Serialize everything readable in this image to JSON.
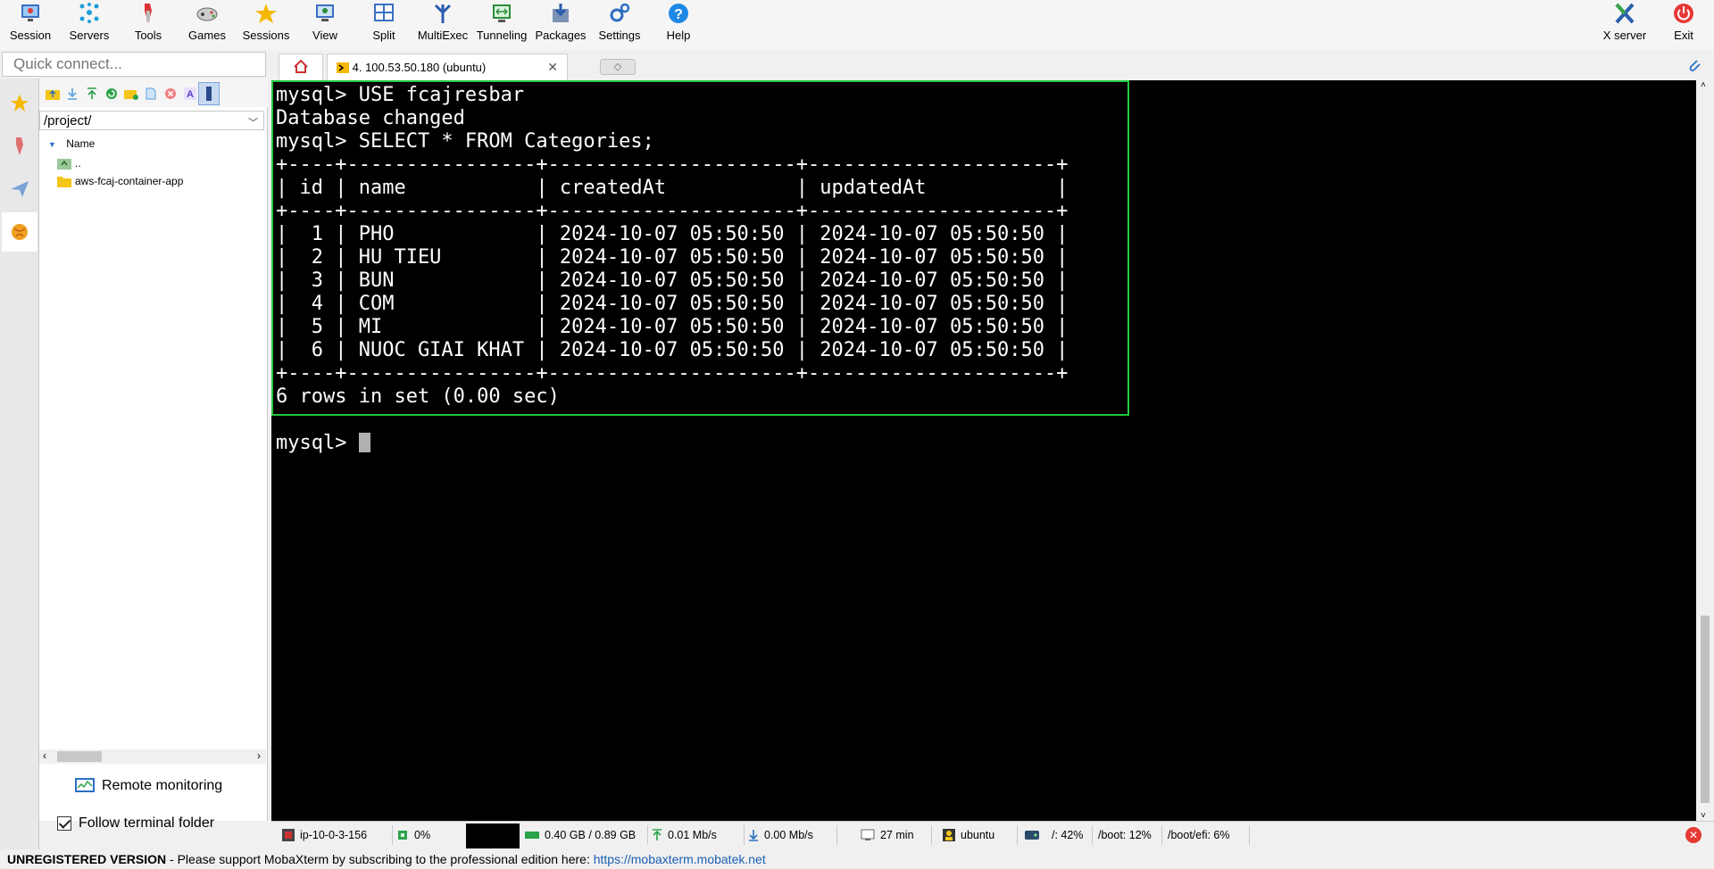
{
  "toolbar": {
    "buttons": [
      {
        "label": "Session",
        "icon": "session-icon"
      },
      {
        "label": "Servers",
        "icon": "servers-icon"
      },
      {
        "label": "Tools",
        "icon": "tools-icon"
      },
      {
        "label": "Games",
        "icon": "games-icon"
      },
      {
        "label": "Sessions",
        "icon": "sessions-star-icon"
      },
      {
        "label": "View",
        "icon": "view-icon"
      },
      {
        "label": "Split",
        "icon": "split-icon"
      },
      {
        "label": "MultiExec",
        "icon": "multiexec-icon"
      },
      {
        "label": "Tunneling",
        "icon": "tunneling-icon"
      },
      {
        "label": "Packages",
        "icon": "packages-icon"
      },
      {
        "label": "Settings",
        "icon": "settings-icon"
      },
      {
        "label": "Help",
        "icon": "help-icon"
      }
    ],
    "right_buttons": [
      {
        "label": "X server",
        "icon": "x-server-icon"
      },
      {
        "label": "Exit",
        "icon": "exit-icon"
      }
    ]
  },
  "quick_connect": {
    "placeholder": "Quick connect..."
  },
  "tabs": {
    "active_label": "4. 100.53.50.180 (ubuntu)"
  },
  "sidebar": {
    "path": "/project/",
    "tree_header": "Name",
    "items": [
      {
        "label": "..",
        "icon": "parent-folder-icon"
      },
      {
        "label": "aws-fcaj-container-app",
        "icon": "folder-icon"
      }
    ],
    "remote_monitoring": "Remote monitoring",
    "follow_terminal": "Follow terminal folder"
  },
  "terminal": {
    "lines": [
      "mysql> USE fcajresbar",
      "Database changed",
      "mysql> SELECT * FROM Categories;",
      "+----+----------------+---------------------+---------------------+",
      "| id | name           | createdAt           | updatedAt           |",
      "+----+----------------+---------------------+---------------------+",
      "|  1 | PHO            | 2024-10-07 05:50:50 | 2024-10-07 05:50:50 |",
      "|  2 | HU TIEU        | 2024-10-07 05:50:50 | 2024-10-07 05:50:50 |",
      "|  3 | BUN            | 2024-10-07 05:50:50 | 2024-10-07 05:50:50 |",
      "|  4 | COM            | 2024-10-07 05:50:50 | 2024-10-07 05:50:50 |",
      "|  5 | MI             | 2024-10-07 05:50:50 | 2024-10-07 05:50:50 |",
      "|  6 | NUOC GIAI KHAT | 2024-10-07 05:50:50 | 2024-10-07 05:50:50 |",
      "+----+----------------+---------------------+---------------------+",
      "6 rows in set (0.00 sec)",
      "",
      "mysql> "
    ]
  },
  "statusbar": {
    "host": "ip-10-0-3-156",
    "cpu": "0%",
    "memory": "0.40 GB / 0.89 GB",
    "upload": "0.01 Mb/s",
    "download": "0.00 Mb/s",
    "uptime": "27 min",
    "user": "ubuntu",
    "disk_root": "/: 42%",
    "disk_boot": "/boot: 12%",
    "disk_boot_efi": "/boot/efi: 6%"
  },
  "footer": {
    "version": "UNREGISTERED VERSION",
    "message": " -  Please support MobaXterm by subscribing to the professional edition here: ",
    "link": "https://mobaxterm.mobatek.net"
  },
  "colors": {
    "highlight_border": "#21c93b",
    "terminal_bg": "#000000",
    "terminal_fg": "#ffffff"
  }
}
